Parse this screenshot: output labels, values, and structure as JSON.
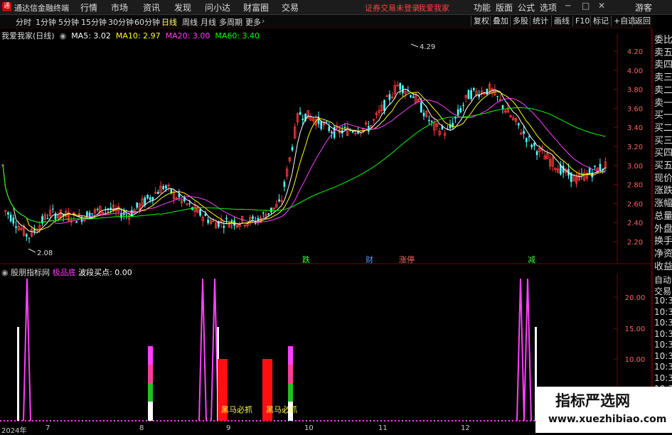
{
  "window": {
    "title": "通达信金融终端",
    "notice": "证券交易未登录",
    "user": "我爱我家",
    "guest": "游客",
    "menu": [
      "行情",
      "市场",
      "资讯",
      "发现",
      "问小达",
      "财富圈",
      "交易"
    ],
    "right_menu": [
      "功能",
      "版面",
      "公式",
      "选项"
    ],
    "window_controls": [
      "─",
      "□",
      "✕"
    ]
  },
  "toolbar": {
    "periods": [
      "分时",
      "1分钟",
      "5分钟",
      "15分钟",
      "30分钟",
      "60分钟",
      "日线",
      "周线",
      "月线",
      "多周期",
      "更多"
    ],
    "active_period": "日线",
    "right_buttons": [
      "复权",
      "叠加",
      "多股",
      "统计",
      "画线",
      "F10",
      "标记",
      "+自选",
      "返回"
    ]
  },
  "main_chart": {
    "stock": "我爱我家(日线)",
    "ma": [
      {
        "label": "MA5: 3.02",
        "color": "#ffffff"
      },
      {
        "label": "MA10: 2.97",
        "color": "#ffff00"
      },
      {
        "label": "MA20: 3.00",
        "color": "#ff40ff"
      },
      {
        "label": "MA60: 3.40",
        "color": "#00ff00"
      }
    ],
    "y_ticks": [
      "4.20",
      "4.00",
      "3.80",
      "3.60",
      "3.40",
      "3.20",
      "3.00",
      "2.80",
      "2.60",
      "2.40",
      "2.20"
    ],
    "high_label": "4.29",
    "low_label": "2.08",
    "markers": [
      {
        "text": "跌",
        "color": "#33ff33"
      },
      {
        "text": "财",
        "color": "#5599ff"
      },
      {
        "text": "涨停",
        "color": "#ff6666"
      },
      {
        "text": "减",
        "color": "#33ff33"
      }
    ]
  },
  "indicator": {
    "name": "股朋指标网",
    "items": [
      {
        "label": "极品底",
        "color": "#ff40ff"
      },
      {
        "label": "波段买点: 0.00",
        "color": "#ffffff"
      }
    ],
    "y_ticks": [
      "20.00",
      "15.00",
      "10.00"
    ],
    "labels": [
      "黑马必抓",
      "黑马必抓"
    ]
  },
  "right_panel": {
    "items": [
      "委比",
      "卖五",
      "卖四",
      "卖三",
      "卖二",
      "卖一",
      "买一",
      "买二",
      "买三",
      "买四",
      "买五",
      "现价",
      "涨跌",
      "涨幅",
      "总量",
      "外盘",
      "换手",
      "净资",
      "收益"
    ],
    "panel2": [
      "自动",
      "交易",
      "10:3",
      "10:3",
      "10:3",
      "10:3",
      "10:3",
      "10:3",
      "10:3",
      "10:3",
      "10:3",
      "10:3",
      "10:3",
      "10:3"
    ]
  },
  "dates": [
    "2024年",
    "7",
    "8",
    "9",
    "10",
    "11",
    "12"
  ],
  "watermark": {
    "title": "指标严选网",
    "url": "www.xuezhibiao.com"
  }
}
